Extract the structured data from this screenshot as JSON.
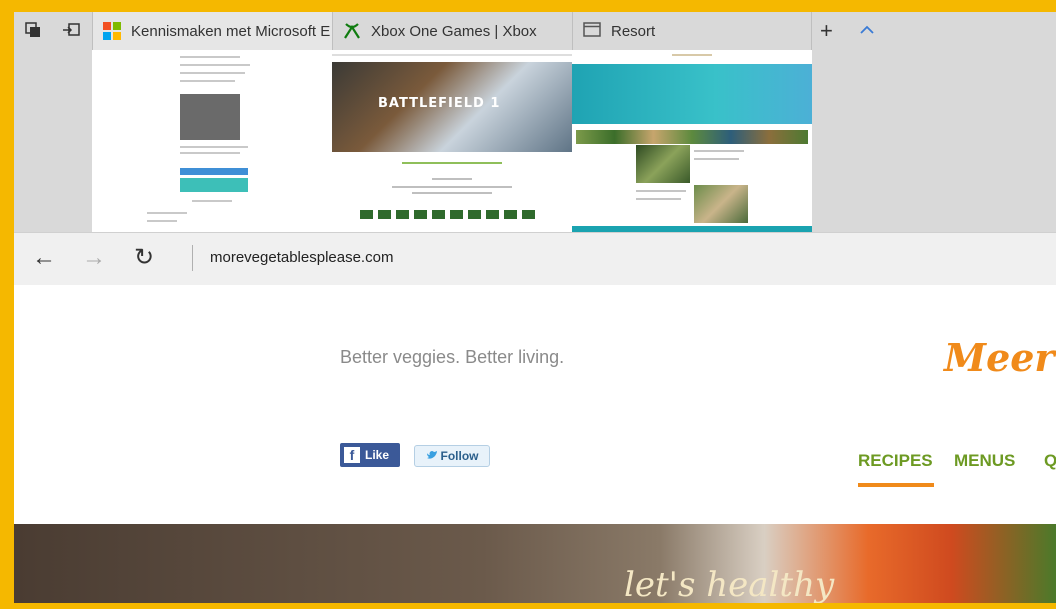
{
  "browser": {
    "tabs": [
      {
        "title": "Kennismaken met Microsoft E",
        "icon": "microsoft-logo-icon"
      },
      {
        "title": "Xbox One Games | Xbox",
        "icon": "xbox-logo-icon"
      },
      {
        "title": "Resort",
        "icon": "window-icon"
      }
    ],
    "new_tab": "+",
    "collapse": "^",
    "back": "←",
    "forward": "→",
    "refresh": "↻",
    "url": "morevegetablesplease.com"
  },
  "previews": {
    "xbox_hero_text": "BATTLEFIELD 1"
  },
  "page": {
    "tagline": "Better veggies. Better living.",
    "logo": "Meer",
    "facebook_like": "Like",
    "twitter_follow": "Follow",
    "menu": [
      {
        "label": "RECIPES",
        "active": true
      },
      {
        "label": "MENUS",
        "active": false
      },
      {
        "label": "Q",
        "active": false
      }
    ],
    "hero_script": "let's healthy"
  },
  "colors": {
    "highlight_border": "#f5b800",
    "menu_green": "#6d9a23",
    "accent_orange": "#f08a1a"
  }
}
